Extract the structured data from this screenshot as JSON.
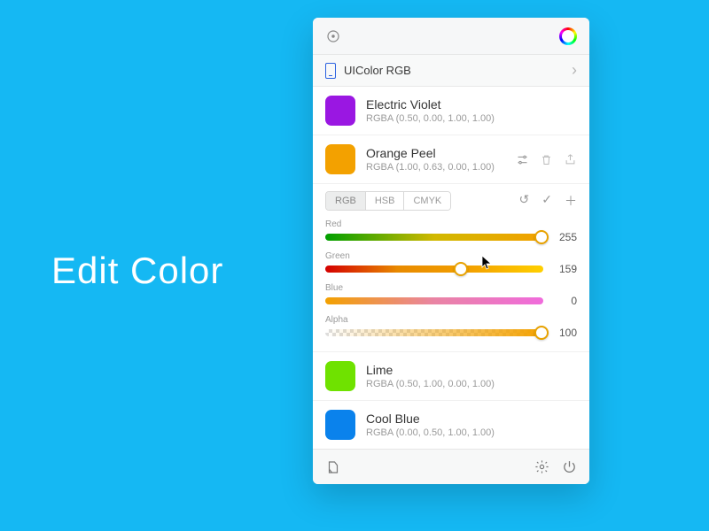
{
  "headline": "Edit Color",
  "format": {
    "label": "UIColor RGB"
  },
  "colors": [
    {
      "name": "Electric Violet",
      "rgba": "RGBA (0.50, 0.00, 1.00, 1.00)",
      "hex": "#9a17e2"
    },
    {
      "name": "Orange Peel",
      "rgba": "RGBA (1.00, 0.63, 0.00, 1.00)",
      "hex": "#f3a100"
    },
    {
      "name": "Lime",
      "rgba": "RGBA (0.50, 1.00, 0.00, 1.00)",
      "hex": "#6fe200"
    },
    {
      "name": "Cool Blue",
      "rgba": "RGBA (0.00, 0.50, 1.00, 1.00)",
      "hex": "#0a82ec"
    }
  ],
  "editor": {
    "modes": [
      "RGB",
      "HSB",
      "CMYK"
    ],
    "active_mode": 0,
    "sliders": {
      "red": {
        "label": "Red",
        "value": 255,
        "max": 255,
        "pos": 99
      },
      "green": {
        "label": "Green",
        "value": 159,
        "max": 255,
        "pos": 62
      },
      "blue": {
        "label": "Blue",
        "value": 0,
        "max": 255,
        "pos": 0
      },
      "alpha": {
        "label": "Alpha",
        "value": 100,
        "max": 100,
        "pos": 99
      }
    }
  }
}
